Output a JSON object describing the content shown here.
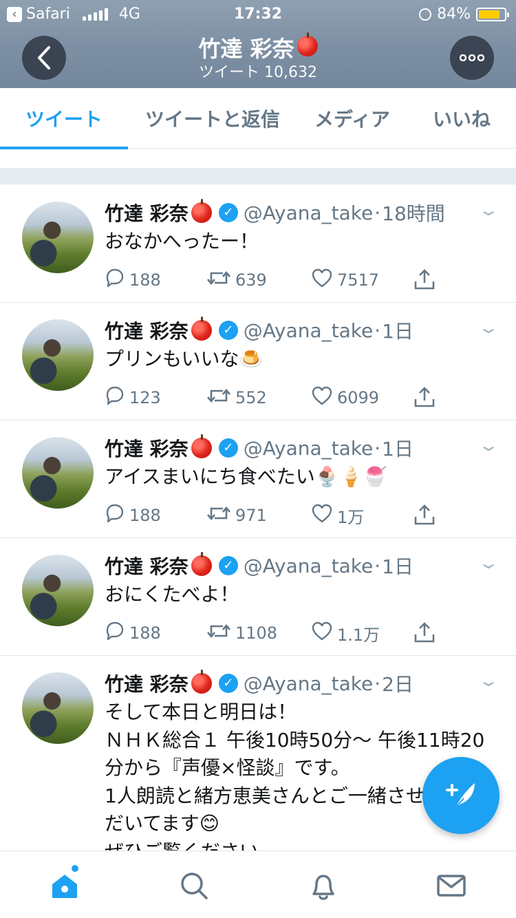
{
  "status_bar": {
    "carrier": "Safari",
    "network": "4G",
    "time": "17:32",
    "battery": "84%",
    "battery_level": 0.84
  },
  "header": {
    "title": "竹達 彩奈",
    "subtitle": "ツイート 10,632"
  },
  "tabs": [
    {
      "label": "ツイート",
      "active": true
    },
    {
      "label": "ツイートと返信",
      "active": false
    },
    {
      "label": "メディア",
      "active": false
    },
    {
      "label": "いいね",
      "active": false
    }
  ],
  "tweets": [
    {
      "name": "竹達 彩奈",
      "handle": "@Ayana_take",
      "time": "18時間",
      "text": "おなかへったー！",
      "replies": "188",
      "retweets": "639",
      "likes": "7517"
    },
    {
      "name": "竹達 彩奈",
      "handle": "@Ayana_take",
      "time": "1日",
      "text": "プリンもいいな🍮",
      "replies": "123",
      "retweets": "552",
      "likes": "6099"
    },
    {
      "name": "竹達 彩奈",
      "handle": "@Ayana_take",
      "time": "1日",
      "text": "アイスまいにち食べたい🍨🍦🍧",
      "replies": "188",
      "retweets": "971",
      "likes": "1万"
    },
    {
      "name": "竹達 彩奈",
      "handle": "@Ayana_take",
      "time": "1日",
      "text": "おにくたべよ！",
      "replies": "188",
      "retweets": "1108",
      "likes": "1.1万"
    },
    {
      "name": "竹達 彩奈",
      "handle": "@Ayana_take",
      "time": "2日",
      "text": "そして本日と明日は！\nＮＨＫ総合１ 午後10時50分〜 午後11時20分から『声優×怪談』です。\n1人朗読と緒方恵美さんとご一緒させていただいてます😊\nぜひご覧ください。"
    }
  ],
  "icons": {
    "reply": "reply-icon",
    "retweet": "retweet-icon",
    "like": "heart-icon",
    "share": "share-icon",
    "verified": "verified-badge-icon",
    "apple": "apple-emoji-icon"
  },
  "colors": {
    "accent": "#1da1f2",
    "header_bg": "#7d8fa3",
    "muted": "#657786"
  }
}
